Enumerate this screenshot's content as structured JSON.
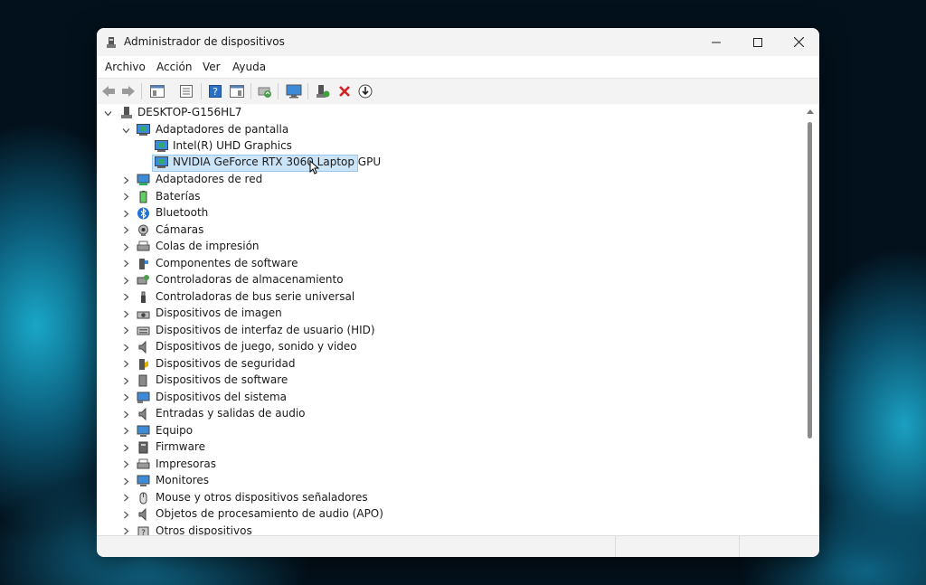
{
  "window": {
    "title": "Administrador de dispositivos"
  },
  "menu": [
    "Archivo",
    "Acción",
    "Ver",
    "Ayuda"
  ],
  "toolbar_icons": [
    "back-icon",
    "forward-icon",
    "show-hide-console-tree-icon",
    "properties-icon",
    "help-icon",
    "show-action-pane-icon",
    "scan-hardware-changes-icon",
    "monitor-icon",
    "update-driver-icon",
    "uninstall-device-icon",
    "disable-device-icon"
  ],
  "tree": {
    "root": "DESKTOP-G156HL7",
    "expanded_category": "Adaptadores de pantalla",
    "expanded_children": [
      "Intel(R) UHD Graphics",
      "NVIDIA GeForce RTX 3060 Laptop GPU"
    ],
    "selected": "NVIDIA GeForce RTX 3060 Laptop GPU",
    "categories": [
      {
        "label": "Adaptadores de red",
        "icon": "network-adapter-icon"
      },
      {
        "label": "Baterías",
        "icon": "battery-icon"
      },
      {
        "label": "Bluetooth",
        "icon": "bluetooth-icon"
      },
      {
        "label": "Cámaras",
        "icon": "camera-icon"
      },
      {
        "label": "Colas de impresión",
        "icon": "print-queue-icon"
      },
      {
        "label": "Componentes de software",
        "icon": "software-component-icon"
      },
      {
        "label": "Controladoras de almacenamiento",
        "icon": "storage-controller-icon"
      },
      {
        "label": "Controladoras de bus serie universal",
        "icon": "usb-icon"
      },
      {
        "label": "Dispositivos de imagen",
        "icon": "imaging-device-icon"
      },
      {
        "label": "Dispositivos de interfaz de usuario (HID)",
        "icon": "hid-icon"
      },
      {
        "label": "Dispositivos de juego, sonido y video",
        "icon": "sound-icon"
      },
      {
        "label": "Dispositivos de seguridad",
        "icon": "security-device-icon"
      },
      {
        "label": "Dispositivos de software",
        "icon": "software-device-icon"
      },
      {
        "label": "Dispositivos del sistema",
        "icon": "system-device-icon"
      },
      {
        "label": "Entradas y salidas de audio",
        "icon": "audio-io-icon"
      },
      {
        "label": "Equipo",
        "icon": "computer-icon"
      },
      {
        "label": "Firmware",
        "icon": "firmware-icon"
      },
      {
        "label": "Impresoras",
        "icon": "printer-icon"
      },
      {
        "label": "Monitores",
        "icon": "monitor-icon"
      },
      {
        "label": "Mouse y otros dispositivos señaladores",
        "icon": "mouse-icon"
      },
      {
        "label": "Objetos de procesamiento de audio (APO)",
        "icon": "audio-processing-icon"
      },
      {
        "label": "Otros dispositivos",
        "icon": "other-device-icon"
      }
    ]
  },
  "colors": {
    "selection": "#cce4f7",
    "selection_border": "#99c9ef",
    "chrome": "#f3f3f3"
  }
}
